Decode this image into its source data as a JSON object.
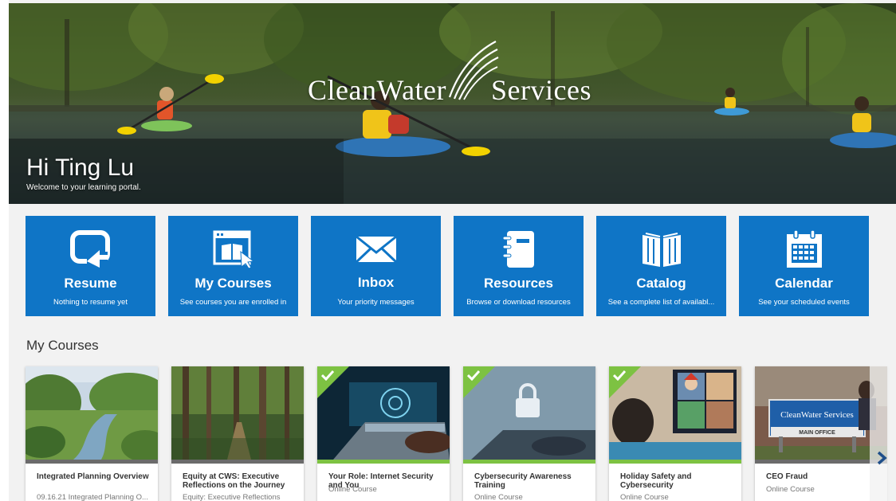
{
  "hero": {
    "logo_word1": "CleanWater",
    "logo_word2": "Services",
    "greeting": "Hi Ting Lu",
    "welcome": "Welcome to your learning portal."
  },
  "tiles": [
    {
      "icon": "resume-icon",
      "title": "Resume",
      "subtitle": "Nothing to resume yet"
    },
    {
      "icon": "my-courses-icon",
      "title": "My Courses",
      "subtitle": "See courses you are enrolled in"
    },
    {
      "icon": "envelope-icon",
      "title": "Inbox",
      "subtitle": "Your priority messages"
    },
    {
      "icon": "notebook-icon",
      "title": "Resources",
      "subtitle": "Browse or download resources"
    },
    {
      "icon": "book-icon",
      "title": "Catalog",
      "subtitle": "See a complete list of availabl..."
    },
    {
      "icon": "calendar-icon",
      "title": "Calendar",
      "subtitle": "See your scheduled events"
    }
  ],
  "section_title": "My Courses",
  "courses": [
    {
      "title": "Integrated Planning Overview",
      "subtitle": "09.16.21 Integrated Planning O...",
      "completed": false
    },
    {
      "title": "Equity at CWS: Executive Reflections on the Journey",
      "subtitle": "Equity: Executive Reflections",
      "completed": false
    },
    {
      "title": "Your Role: Internet Security and You",
      "subtitle": "Online Course",
      "completed": true
    },
    {
      "title": "Cybersecurity Awareness Training",
      "subtitle": "Online Course",
      "completed": true
    },
    {
      "title": "Holiday Safety and Cybersecurity",
      "subtitle": "Online Course",
      "completed": true
    },
    {
      "title": "CEO Fraud",
      "subtitle": "Online Course",
      "completed": false
    }
  ],
  "sign": {
    "logo": "CleanWater Services",
    "label": "MAIN OFFICE"
  },
  "colors": {
    "tile_blue": "#0f75c6",
    "complete_green": "#7dc242",
    "background": "#f2f2f2"
  }
}
